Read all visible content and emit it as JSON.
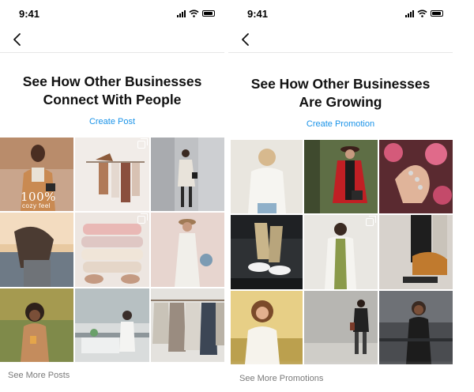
{
  "left_screen": {
    "status": {
      "time": "9:41"
    },
    "headline_line1": "See How Other Businesses",
    "headline_line2": "Connect With People",
    "cta_label": "Create Post",
    "photo_overlay_big": "100%",
    "photo_overlay_small": "cozy feel",
    "see_more_label": "See More Posts"
  },
  "right_screen": {
    "status": {
      "time": "9:41"
    },
    "headline_line1": "See How Other Businesses",
    "headline_line2": "Are Growing",
    "cta_label": "Create Promotion",
    "see_more_label": "See More Promotions"
  },
  "icons": {
    "back": "chevron-left-icon",
    "signal": "cellular-signal-icon",
    "wifi": "wifi-icon",
    "battery": "battery-icon",
    "multi_photo": "multiple-photos-icon"
  },
  "colors": {
    "accent": "#1a93e8",
    "headline": "#111111",
    "muted": "#7a7a7a"
  }
}
